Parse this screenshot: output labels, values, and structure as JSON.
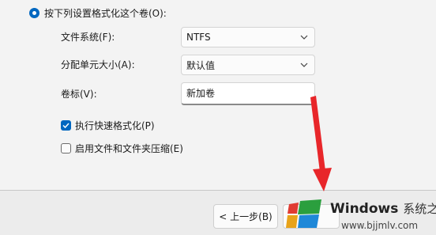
{
  "format": {
    "radio_label": "按下列设置格式化这个卷(O):",
    "file_system_label": "文件系统(F):",
    "file_system_value": "NTFS",
    "unit_size_label": "分配单元大小(A):",
    "unit_size_value": "默认值",
    "volume_label_label": "卷标(V):",
    "volume_label_value": "新加卷",
    "quick_format_label": "执行快速格式化(P)",
    "quick_format_checked": true,
    "compression_label": "启用文件和文件夹压缩(E)",
    "compression_checked": false
  },
  "footer": {
    "back_label": "< 上一步(B)"
  },
  "watermark": {
    "brand": "Windows",
    "cn": "系统之家",
    "url": "www.bjjmlv.com"
  },
  "colors": {
    "accent": "#0067c0",
    "arrow": "#e8262a"
  },
  "icons": {
    "dropdown": "chevron-down-icon",
    "check": "checkmark-icon",
    "logo": "windows-logo-icon"
  }
}
